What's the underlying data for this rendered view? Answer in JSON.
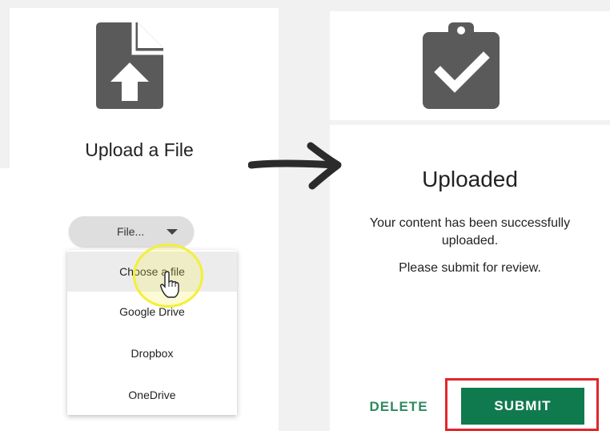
{
  "left": {
    "title": "Upload a File",
    "icon": "file-upload-icon",
    "file_select": {
      "label": "File..."
    },
    "dropdown": {
      "items": [
        {
          "label": "Choose a file"
        },
        {
          "label": "Google Drive"
        },
        {
          "label": "Dropbox"
        },
        {
          "label": "OneDrive"
        }
      ]
    }
  },
  "right": {
    "title": "Uploaded",
    "icon": "clipboard-check-icon",
    "message_line1": "Your content has been successfully",
    "message_line2": "uploaded.",
    "message_line3": "Please submit for review.",
    "delete_label": "DELETE",
    "submit_label": "SUBMIT"
  },
  "colors": {
    "icon_gray": "#5a5a5a",
    "brand_green": "#107a4f",
    "delete_green": "#2e8a60",
    "highlight_red": "#e2262b",
    "cursor_yellow": "#f3ef3a"
  }
}
